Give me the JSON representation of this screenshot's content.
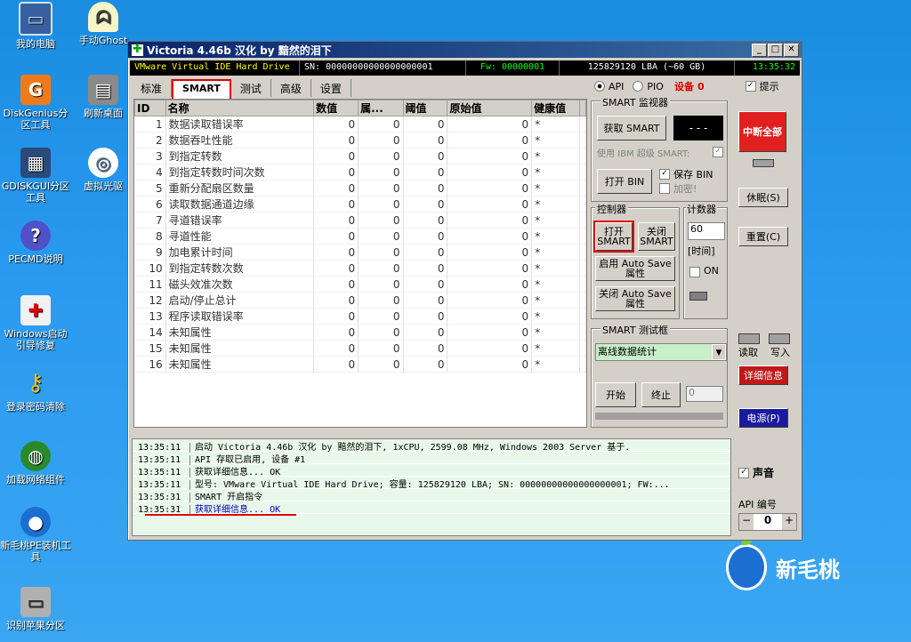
{
  "desktop": {
    "icons": [
      {
        "name": "my-computer-icon",
        "label": "我的电脑",
        "x": 0,
        "y": 0
      },
      {
        "name": "ghost-icon",
        "label": "手动Ghost"
      },
      {
        "name": "diskgenius-icon",
        "label": "DiskGenius分区工具"
      },
      {
        "name": "refresh-desktop-icon",
        "label": "刷新桌面"
      },
      {
        "name": "gdiskgui-icon",
        "label": "GDISKGUI分区工具"
      },
      {
        "name": "virtual-cd-icon",
        "label": "虚拟光驱"
      },
      {
        "name": "pecmd-help-icon",
        "label": "PECMD说明"
      },
      {
        "name": "windows-boot-repair-icon",
        "label": "Windows启动引导修复"
      },
      {
        "name": "password-clear-icon",
        "label": "登录密码清除"
      },
      {
        "name": "network-component-icon",
        "label": "加载网络组件"
      },
      {
        "name": "xinmaotao-installer-icon",
        "label": "新毛桃PE装机工具"
      },
      {
        "name": "apple-partition-icon",
        "label": "识别苹果分区"
      }
    ],
    "brand": "新毛桃"
  },
  "window": {
    "title": "Victoria 4.46b 汉化 by 黯然的泪下",
    "info": {
      "drive": "VMware Virtual IDE Hard Drive",
      "sn": "SN: 00000000000000000001",
      "fw": "Fw: 00000001",
      "lba": "125829120 LBA (~60 GB)",
      "time": "13:35:32"
    },
    "tabs": [
      "标准",
      "SMART",
      "测试",
      "高级",
      "设置"
    ],
    "selected_tab": "SMART",
    "api_label": "API",
    "pio_label": "PIO",
    "device_label": "设备",
    "device_value": "0",
    "hint_label": "提示",
    "columns": [
      "ID",
      "名称",
      "数值",
      "属...",
      "阈值",
      "原始值",
      "健康值"
    ],
    "rows": [
      [
        "1",
        "数据读取错误率",
        "0",
        "0",
        "0",
        "0",
        "*"
      ],
      [
        "2",
        "数据吞吐性能",
        "0",
        "0",
        "0",
        "0",
        "*"
      ],
      [
        "3",
        "到指定转数",
        "0",
        "0",
        "0",
        "0",
        "*"
      ],
      [
        "4",
        "到指定转数时间次数",
        "0",
        "0",
        "0",
        "0",
        "*"
      ],
      [
        "5",
        "重新分配扇区数量",
        "0",
        "0",
        "0",
        "0",
        "*"
      ],
      [
        "6",
        "读取数据通道边缘",
        "0",
        "0",
        "0",
        "0",
        "*"
      ],
      [
        "7",
        "寻道错误率",
        "0",
        "0",
        "0",
        "0",
        "*"
      ],
      [
        "8",
        "寻道性能",
        "0",
        "0",
        "0",
        "0",
        "*"
      ],
      [
        "9",
        "加电累计时间",
        "0",
        "0",
        "0",
        "0",
        "*"
      ],
      [
        "10",
        "到指定转数次数",
        "0",
        "0",
        "0",
        "0",
        "*"
      ],
      [
        "11",
        "磁头效准次数",
        "0",
        "0",
        "0",
        "0",
        "*"
      ],
      [
        "12",
        "启动/停止总计",
        "0",
        "0",
        "0",
        "0",
        "*"
      ],
      [
        "13",
        "程序读取错误率",
        "0",
        "0",
        "0",
        "0",
        "*"
      ],
      [
        "14",
        "未知属性",
        "0",
        "0",
        "0",
        "0",
        "*"
      ],
      [
        "15",
        "未知属性",
        "0",
        "0",
        "0",
        "0",
        "*"
      ],
      [
        "16",
        "未知属性",
        "0",
        "0",
        "0",
        "0",
        "*"
      ]
    ],
    "smart_monitor": {
      "title": "SMART 监视器",
      "get_smart": "获取 SMART",
      "display": "- - -",
      "use_ibm": "使用 IBM 超级 SMART:",
      "open_bin": "打开 BIN",
      "save_bin": "保存 BIN",
      "encrypt": "加密!"
    },
    "controller": {
      "title": "控制器",
      "open_smart": "打开 SMART",
      "close_smart": "关闭 SMART",
      "enable_auto": "启用 Auto Save 属性",
      "disable_auto": "关闭 Auto Save 属性"
    },
    "counter": {
      "title": "计数器",
      "value": "60",
      "unit": "[时间]",
      "on_label": "ON"
    },
    "smart_test": {
      "title": "SMART 测试框",
      "selected": "离线数据统计",
      "start": "开始",
      "stop": "终止",
      "value": "0"
    },
    "right": {
      "break_all": "中断全部",
      "sleep": "休眠(S)",
      "reset": "重置(C)",
      "read": "读取",
      "write": "写入",
      "details": "详细信息",
      "power": "电源(P)",
      "sound": "声音",
      "api_number_label": "API 编号",
      "api_number": "0",
      "minus": "−",
      "plus": "+"
    },
    "log": [
      {
        "t": "13:35:11",
        "msg": "启动 Victoria 4.46b 汉化 by 黯然的泪下, 1xCPU, 2599.08 MHz, Windows 2003 Server 基于."
      },
      {
        "t": "13:35:11",
        "msg": "API 存取已启用, 设备 #1"
      },
      {
        "t": "13:35:11",
        "msg": "获取详细信息... OK"
      },
      {
        "t": "13:35:11",
        "msg": "型号:  VMware Virtual IDE Hard Drive;    容量: 125829120 LBA; SN: 00000000000000000001; FW:..."
      },
      {
        "t": "13:35:31",
        "msg": "SMART 开启指令"
      },
      {
        "t": "13:35:31",
        "msg": "获取详细信息... OK"
      }
    ]
  }
}
